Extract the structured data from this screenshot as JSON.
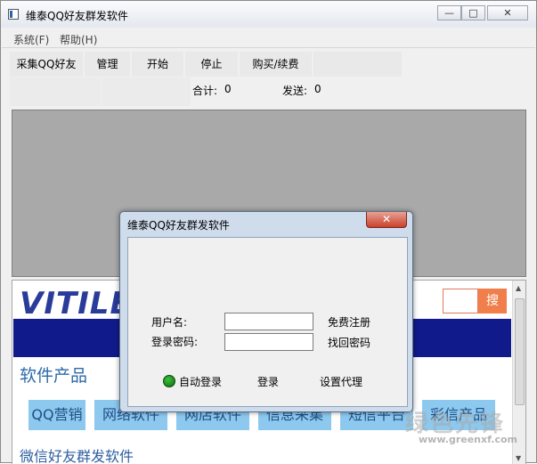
{
  "window": {
    "title": "维泰QQ好友群发软件",
    "min": "—",
    "max": "□",
    "close": "✕"
  },
  "menu": {
    "system": "系统(F)",
    "help": "帮助(H)"
  },
  "toolbar": {
    "collect": "采集QQ好友",
    "manage": "管理",
    "start": "开始",
    "stop": "停止",
    "buy": "购买/续费"
  },
  "stats": {
    "total_label": "合计:",
    "total_value": "0",
    "sent_label": "发送:",
    "sent_value": "0"
  },
  "web": {
    "logo": "VITILE",
    "search_button": "搜",
    "section_title": "软件产品",
    "categories": [
      "QQ营销",
      "网络软件",
      "网店软件",
      "信息采集",
      "短信平台",
      "彩信产品"
    ],
    "weixin_title": "微信好友群发软件"
  },
  "dialog": {
    "title": "维泰QQ好友群发软件",
    "close": "✕",
    "username_label": "用户名:",
    "password_label": "登录密码:",
    "register_link": "免费注册",
    "recover_link": "找回密码",
    "auto_login": "自动登录",
    "login_button": "登录",
    "proxy_button": "设置代理"
  },
  "watermark": {
    "main": "绿色先锋",
    "url": "www.greenxf.com"
  }
}
